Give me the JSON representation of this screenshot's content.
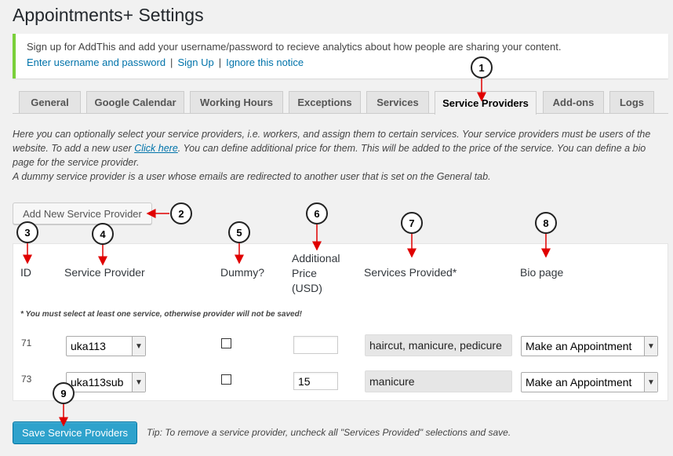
{
  "page": {
    "title": "Appointments+ Settings"
  },
  "notice": {
    "text": "Sign up for AddThis and add your username/password to recieve analytics about how people are sharing your content.",
    "link_enter": "Enter username and password",
    "link_signup": "Sign Up",
    "link_ignore": "Ignore this notice",
    "separator": "|",
    "accent_color": "#7ad03a"
  },
  "tabs": [
    {
      "label": "General"
    },
    {
      "label": "Google Calendar"
    },
    {
      "label": "Working Hours"
    },
    {
      "label": "Exceptions"
    },
    {
      "label": "Services"
    },
    {
      "label": "Service Providers",
      "active": true
    },
    {
      "label": "Add-ons"
    },
    {
      "label": "Logs"
    }
  ],
  "description": {
    "line1_pre": "Here you can optionally select your service providers, i.e. workers, and assign them to certain services. Your service providers must be users of the website. To add a new user ",
    "link_click": "Click here",
    "line1_post": ". You can define additional price for them. This will be added to the price of the service. You can define a bio page for the service provider.",
    "line2": "A dummy service provider is a user whose emails are redirected to another user that is set on the General tab."
  },
  "add_button": {
    "label": "Add New Service Provider"
  },
  "table": {
    "headers": {
      "id": "ID",
      "provider": "Service Provider",
      "dummy": "Dummy?",
      "price_line1": "Additional",
      "price_line2": "Price",
      "price_line3": "(USD)",
      "services": "Services Provided*",
      "bio": "Bio page"
    },
    "required_note": "* You must select at least one service, otherwise provider will not be saved!",
    "rows": [
      {
        "id": "71",
        "provider": "uka113",
        "dummy": false,
        "price": "",
        "services": "haircut, manicure, pedicure",
        "bio": "Make an Appointment"
      },
      {
        "id": "73",
        "provider": "uka113sub",
        "dummy": false,
        "price": "15",
        "services": "manicure",
        "bio": "Make an Appointment"
      }
    ]
  },
  "save_button": {
    "label": "Save Service Providers"
  },
  "tip": "Tip: To remove a service provider, uncheck all \"Services Provided\" selections and save.",
  "callouts": [
    "1",
    "2",
    "3",
    "4",
    "5",
    "6",
    "7",
    "8",
    "9"
  ],
  "colors": {
    "link": "#0073aa",
    "primary": "#2ea2cc",
    "arrow": "#e00000"
  },
  "icons": {
    "select_arrow": "chevron-down-icon"
  }
}
